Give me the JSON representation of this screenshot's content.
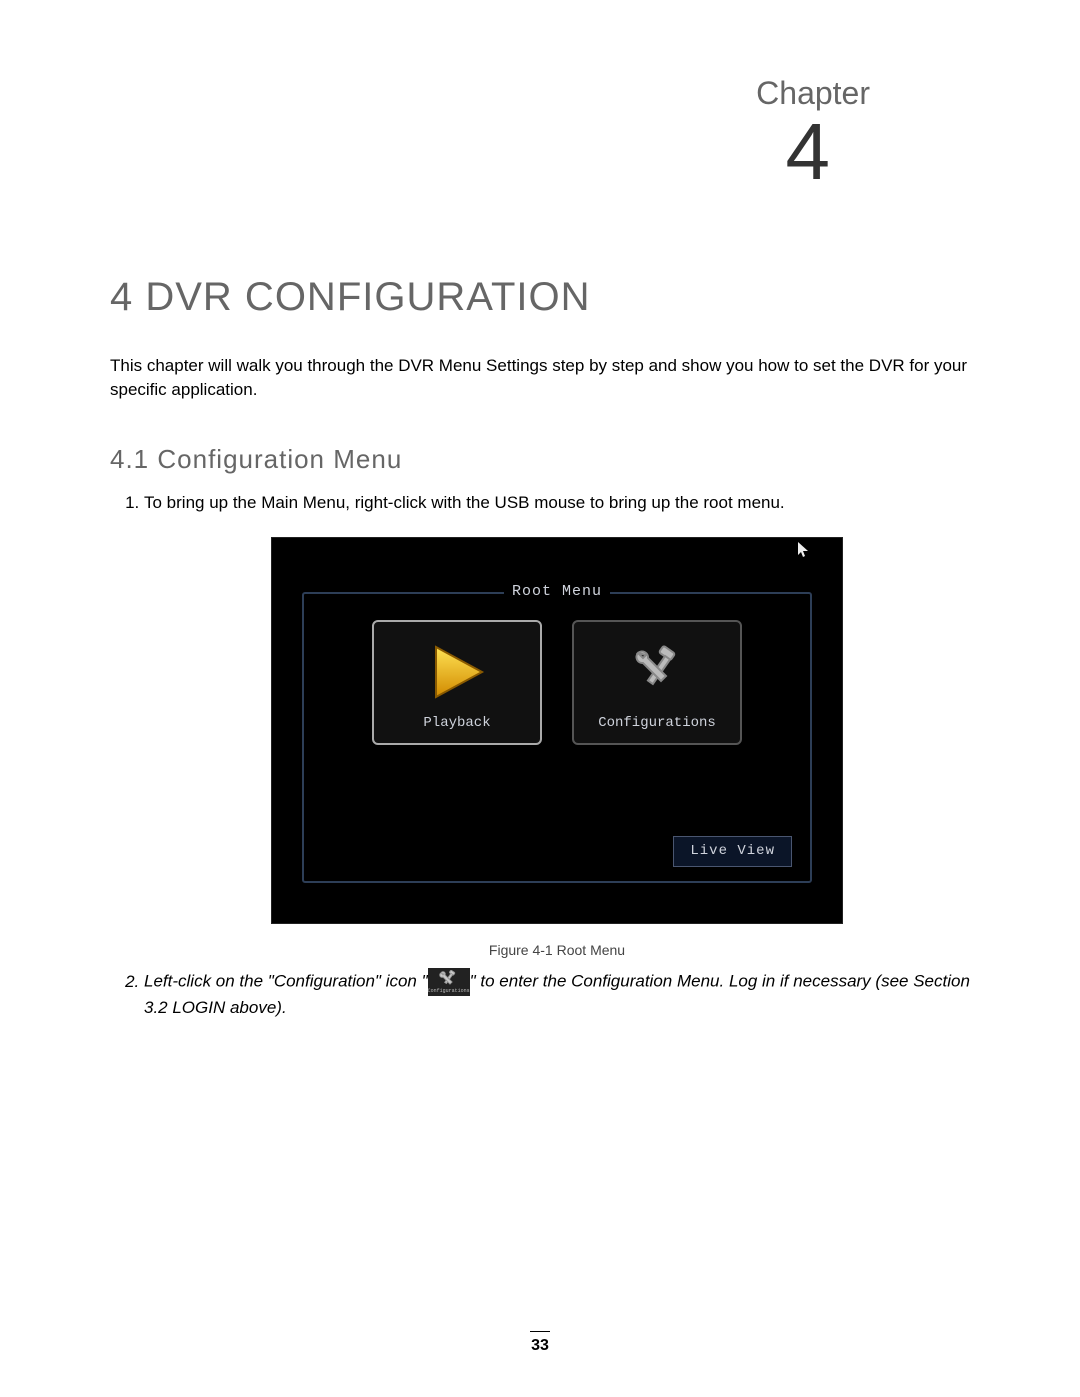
{
  "chapter": {
    "label": "Chapter",
    "number": "4"
  },
  "heading": "4 DVR CONFIGURATION",
  "intro": "This chapter will walk you through the DVR Menu Settings step by step and show you how to set the DVR for your specific application.",
  "section_heading": "4.1  Configuration Menu",
  "steps": {
    "one": "To bring up the Main Menu, right-click with the USB mouse to bring up the root menu.",
    "two_a": "Left-click on the \"Configuration\" icon \"",
    "two_b": "\" to enter the Configuration Menu. Log in if necessary (see Section 3.2 LOGIN above)."
  },
  "root_menu": {
    "title": "Root Menu",
    "tile_playback": "Playback",
    "tile_config": "Configurations",
    "live_view": "Live View"
  },
  "figure_caption": "Figure 4-1 Root Menu",
  "inline_tool_label": "Configurations",
  "page_number": "33"
}
